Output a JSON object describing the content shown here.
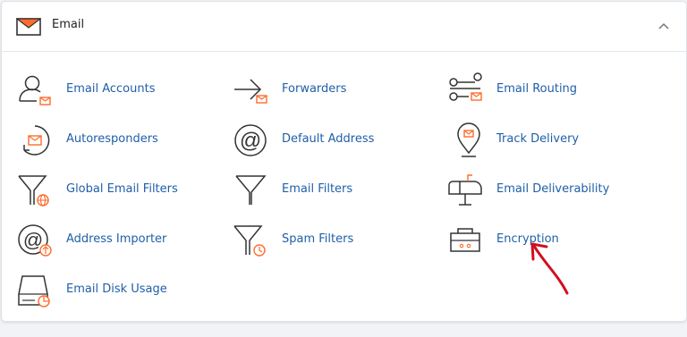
{
  "header": {
    "title": "Email",
    "icon": "envelope-icon"
  },
  "colors": {
    "link": "#1f5fa8",
    "accent": "#ff6c2c",
    "icon": "#333333",
    "arrow": "#d10f1f"
  },
  "items": [
    {
      "label": "Email Accounts",
      "icon": "email-accounts-icon"
    },
    {
      "label": "Forwarders",
      "icon": "forwarders-icon"
    },
    {
      "label": "Email Routing",
      "icon": "email-routing-icon"
    },
    {
      "label": "Autoresponders",
      "icon": "autoresponders-icon"
    },
    {
      "label": "Default Address",
      "icon": "at-sign-icon"
    },
    {
      "label": "Track Delivery",
      "icon": "map-pin-icon"
    },
    {
      "label": "Global Email Filters",
      "icon": "funnel-globe-icon"
    },
    {
      "label": "Email Filters",
      "icon": "funnel-icon"
    },
    {
      "label": "Email Deliverability",
      "icon": "mailbox-icon"
    },
    {
      "label": "Address Importer",
      "icon": "address-importer-icon"
    },
    {
      "label": "Spam Filters",
      "icon": "funnel-clock-icon"
    },
    {
      "label": "Encryption",
      "icon": "lockbox-icon"
    },
    {
      "label": "Email Disk Usage",
      "icon": "disk-usage-icon"
    }
  ]
}
